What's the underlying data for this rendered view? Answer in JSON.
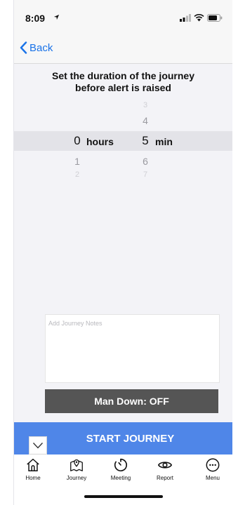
{
  "status_bar": {
    "time": "8:09",
    "icons": [
      "location-arrow-icon",
      "signal-icon",
      "wifi-icon",
      "battery-icon"
    ]
  },
  "nav": {
    "back_label": "Back",
    "accent_color": "#1a73e8"
  },
  "title": {
    "line1": "Set the duration of the journey",
    "line2": "before alert is raised"
  },
  "picker": {
    "hours": {
      "above": "",
      "selected": "0",
      "below1": "1",
      "below2": "2",
      "unit": "hours"
    },
    "minutes": {
      "above2": "3",
      "above1": "4",
      "selected": "5",
      "below1": "6",
      "below2": "7",
      "unit": "min"
    }
  },
  "notes": {
    "placeholder": "Add Journey Notes"
  },
  "man_down": {
    "label": "Man Down: OFF",
    "color": "#555555"
  },
  "start": {
    "label": "START JOURNEY",
    "color": "#4f86e8"
  },
  "tabs": [
    {
      "label": "Home",
      "icon": "home-icon"
    },
    {
      "label": "Journey",
      "icon": "map-pin-icon"
    },
    {
      "label": "Meeting",
      "icon": "timer-icon"
    },
    {
      "label": "Report",
      "icon": "eye-icon"
    },
    {
      "label": "Menu",
      "icon": "more-icon"
    }
  ]
}
